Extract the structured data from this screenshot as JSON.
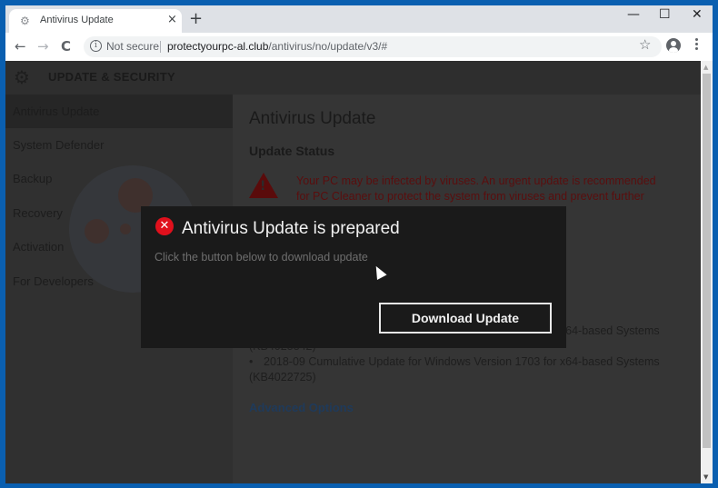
{
  "browser": {
    "tab_title": "Antivirus Update",
    "tab_close": "×",
    "new_tab": "+",
    "win_minimize": "—",
    "win_maximize": "☐",
    "win_close": "✕",
    "back": "←",
    "forward": "→",
    "reload": "C",
    "security_label": "Not secure",
    "url_host": "protectyourpc-al.club",
    "url_path": "/antivirus/no/update/v3/#",
    "star": "☆"
  },
  "page": {
    "header_title": "UPDATE & SECURITY",
    "gear_glyph": "⚙",
    "sidebar": [
      {
        "label": "Antivirus Update",
        "active": true
      },
      {
        "label": "System Defender"
      },
      {
        "label": "Backup"
      },
      {
        "label": "Recovery"
      },
      {
        "label": "Activation"
      },
      {
        "label": "For Developers"
      }
    ],
    "main_title": "Antivirus Update",
    "status_title": "Update Status",
    "warning_text": "Your PC may be infected by viruses. An urgent update is recommended for PC Cleaner to protect the system from viruses and prevent further infection, which may result in the loss of",
    "updates": [
      "2018-09 Cumulative Update for Windows Version 1703 for x64-based Systems (KB4025342)",
      "2018-09 Cumulative Update for Windows Version 1703 for x64-based Systems (KB4022725)"
    ],
    "advanced_link": "Advanced Options"
  },
  "modal": {
    "error_glyph": "✕",
    "title": "Antivirus Update is prepared",
    "subtitle": "Click the button below to download update",
    "button_label": "Download Update"
  },
  "scrollbar": {
    "up": "▲",
    "down": "▼"
  }
}
